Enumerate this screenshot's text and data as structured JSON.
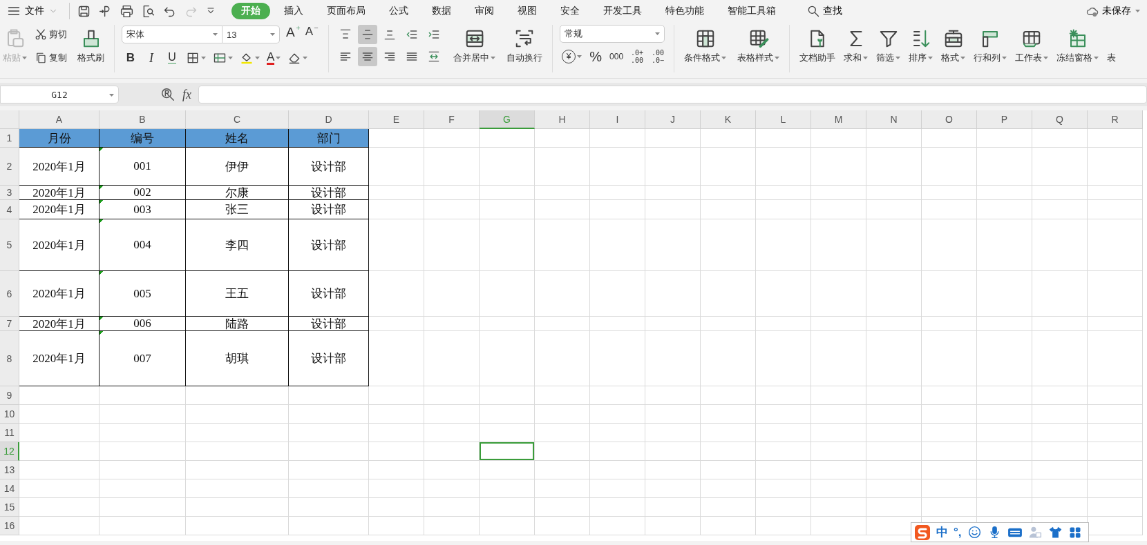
{
  "menu": {
    "label": "文件"
  },
  "quick_access": [
    {
      "kind": "save",
      "disabled": false
    },
    {
      "kind": "export",
      "disabled": false
    },
    {
      "kind": "print",
      "disabled": false
    },
    {
      "kind": "preview",
      "disabled": false
    },
    {
      "kind": "undo",
      "disabled": false
    },
    {
      "kind": "redo",
      "disabled": true
    },
    {
      "kind": "customize",
      "disabled": false
    }
  ],
  "tabs": [
    {
      "label": "开始",
      "selected": true
    },
    {
      "label": "插入",
      "selected": false
    },
    {
      "label": "页面布局",
      "selected": false
    },
    {
      "label": "公式",
      "selected": false
    },
    {
      "label": "数据",
      "selected": false
    },
    {
      "label": "审阅",
      "selected": false
    },
    {
      "label": "视图",
      "selected": false
    },
    {
      "label": "安全",
      "selected": false
    },
    {
      "label": "开发工具",
      "selected": false
    },
    {
      "label": "特色功能",
      "selected": false
    },
    {
      "label": "智能工具箱",
      "selected": false
    }
  ],
  "search": {
    "label": "查找"
  },
  "save_status": "未保存",
  "clipboard": {
    "paste": {
      "label": "粘贴",
      "disabled": true
    },
    "cut": "剪切",
    "copy": "复制",
    "painter": "格式刷"
  },
  "font": {
    "name": "宋体",
    "size": "13",
    "grow": "A",
    "shrink": "A"
  },
  "font_buttons": [
    {
      "kind": "bold",
      "label": "B"
    },
    {
      "kind": "italic",
      "label": "I"
    },
    {
      "kind": "underline",
      "label": "U"
    },
    {
      "kind": "border"
    },
    {
      "kind": "cell-format"
    },
    {
      "kind": "fill"
    },
    {
      "kind": "font-color",
      "label": "A"
    },
    {
      "kind": "clear"
    }
  ],
  "alignment": [
    {
      "kind": "top",
      "selected": false
    },
    {
      "kind": "middle",
      "selected": true
    },
    {
      "kind": "bottom",
      "selected": false
    },
    {
      "kind": "outdent",
      "selected": false
    },
    {
      "kind": "indent",
      "selected": false
    },
    {
      "kind": "left",
      "selected": false
    },
    {
      "kind": "center",
      "selected": true
    },
    {
      "kind": "right",
      "selected": false
    },
    {
      "kind": "justify",
      "selected": false
    },
    {
      "kind": "distributed",
      "selected": false
    }
  ],
  "align_commands": [
    {
      "kind": "merge",
      "label": "合并居中",
      "dropdown": true
    },
    {
      "kind": "wrap",
      "label": "自动换行",
      "dropdown": false
    }
  ],
  "number": {
    "format": "常规",
    "buttons": [
      {
        "kind": "currency",
        "label": "¥"
      },
      {
        "kind": "percent",
        "label": "%"
      },
      {
        "kind": "thousands",
        "label": "000"
      },
      {
        "kind": "add-decimal",
        "top": ".0+",
        "bottom": ".00"
      },
      {
        "kind": "remove-decimal",
        "top": ".00",
        "bottom": ".0−"
      }
    ]
  },
  "style_commands": [
    {
      "kind": "conditional",
      "label": "条件格式",
      "dropdown": true
    },
    {
      "kind": "table-style",
      "label": "表格样式",
      "dropdown": true
    }
  ],
  "data_commands": [
    {
      "kind": "doc-helper",
      "label": "文档助手",
      "dropdown": false
    },
    {
      "kind": "sum",
      "label": "求和",
      "dropdown": true
    },
    {
      "kind": "filter",
      "label": "筛选",
      "dropdown": true
    },
    {
      "kind": "sort",
      "label": "排序",
      "dropdown": true
    },
    {
      "kind": "format",
      "label": "格式",
      "dropdown": true
    },
    {
      "kind": "rows-cols",
      "label": "行和列",
      "dropdown": true
    },
    {
      "kind": "worksheet",
      "label": "工作表",
      "dropdown": true
    },
    {
      "kind": "freeze",
      "label": "冻结窗格",
      "dropdown": true
    },
    {
      "kind": "partial",
      "label": "表",
      "dropdown": false
    }
  ],
  "name_box": "G12",
  "formula_label": "fx",
  "sheet": {
    "columns": [
      {
        "label": "A",
        "selected": false
      },
      {
        "label": "B",
        "selected": false
      },
      {
        "label": "C",
        "selected": false
      },
      {
        "label": "D",
        "selected": false
      },
      {
        "label": "E",
        "selected": false
      },
      {
        "label": "F",
        "selected": false
      },
      {
        "label": "G",
        "selected": true
      },
      {
        "label": "H",
        "selected": false
      },
      {
        "label": "I",
        "selected": false
      },
      {
        "label": "J",
        "selected": false
      },
      {
        "label": "K",
        "selected": false
      },
      {
        "label": "L",
        "selected": false
      },
      {
        "label": "M",
        "selected": false
      },
      {
        "label": "N",
        "selected": false
      },
      {
        "label": "O",
        "selected": false
      },
      {
        "label": "P",
        "selected": false
      },
      {
        "label": "Q",
        "selected": false
      },
      {
        "label": "R",
        "selected": false
      }
    ],
    "rows": [
      {
        "label": "1",
        "selected": false,
        "kind": "header",
        "text_flag": false,
        "cells": [
          "月份",
          "编号",
          "姓名",
          "部门"
        ]
      },
      {
        "label": "2",
        "selected": false,
        "kind": "data",
        "text_flag": true,
        "cells": [
          "2020年1月",
          "001",
          "伊伊",
          "设计部"
        ]
      },
      {
        "label": "3",
        "selected": false,
        "kind": "data",
        "text_flag": true,
        "cells": [
          "2020年1月",
          "002",
          "尔康",
          "设计部"
        ]
      },
      {
        "label": "4",
        "selected": false,
        "kind": "data",
        "text_flag": true,
        "cells": [
          "2020年1月",
          "003",
          "张三",
          "设计部"
        ]
      },
      {
        "label": "5",
        "selected": false,
        "kind": "data",
        "text_flag": true,
        "cells": [
          "2020年1月",
          "004",
          "李四",
          "设计部"
        ]
      },
      {
        "label": "6",
        "selected": false,
        "kind": "data",
        "text_flag": true,
        "cells": [
          "2020年1月",
          "005",
          "王五",
          "设计部"
        ]
      },
      {
        "label": "7",
        "selected": false,
        "kind": "data",
        "text_flag": true,
        "cells": [
          "2020年1月",
          "006",
          "陆路",
          "设计部"
        ]
      },
      {
        "label": "8",
        "selected": false,
        "kind": "data",
        "text_flag": true,
        "cells": [
          "2020年1月",
          "007",
          "胡琪",
          "设计部"
        ]
      },
      {
        "label": "9",
        "selected": false,
        "kind": "blank",
        "text_flag": false
      },
      {
        "label": "10",
        "selected": false,
        "kind": "blank",
        "text_flag": false
      },
      {
        "label": "11",
        "selected": false,
        "kind": "blank",
        "text_flag": false
      },
      {
        "label": "12",
        "selected": true,
        "kind": "blank",
        "text_flag": false
      },
      {
        "label": "13",
        "selected": false,
        "kind": "blank",
        "text_flag": false
      },
      {
        "label": "14",
        "selected": false,
        "kind": "blank",
        "text_flag": false
      },
      {
        "label": "15",
        "selected": false,
        "kind": "blank",
        "text_flag": false
      },
      {
        "label": "16",
        "selected": false,
        "kind": "blank",
        "text_flag": false
      }
    ]
  },
  "ime": {
    "mode": "中",
    "punctuation": "°,"
  }
}
